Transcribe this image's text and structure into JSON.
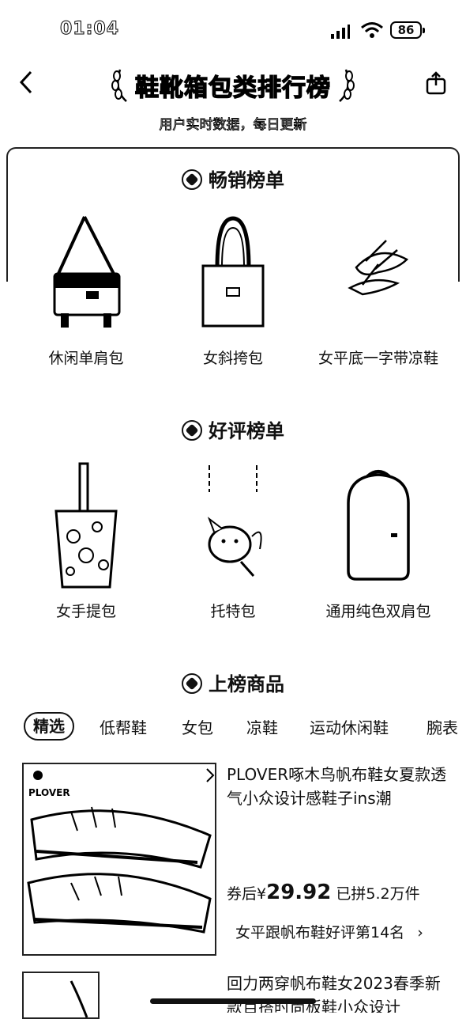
{
  "status_bar": {
    "time": "01:04",
    "battery": "86"
  },
  "header": {
    "title": "鞋靴箱包类排行榜",
    "subtitle": "用户实时数据，每日更新"
  },
  "sections": [
    {
      "title": "畅销榜单",
      "items": [
        {
          "label": "休闲单肩包",
          "icon": "shoulder-bag"
        },
        {
          "label": "女斜挎包",
          "icon": "tote-bag"
        },
        {
          "label": "女平底一字带凉鞋",
          "icon": "sandal"
        }
      ]
    },
    {
      "title": "好评榜单",
      "items": [
        {
          "label": "女手提包",
          "icon": "bucket-bag"
        },
        {
          "label": "托特包",
          "icon": "tote-print"
        },
        {
          "label": "通用纯色双肩包",
          "icon": "backpack"
        }
      ]
    }
  ],
  "listed": {
    "title": "上榜商品",
    "tabs": [
      "精选",
      "低帮鞋",
      "女包",
      "凉鞋",
      "运动休闲鞋",
      "腕表"
    ],
    "active_tab": 0,
    "products": [
      {
        "title": "PLOVER啄木鸟帆布鞋女夏款透气小众设计感鞋子ins潮",
        "price_prefix": "券后",
        "currency": "¥",
        "price": "29.92",
        "sold": "已拼5.2万件",
        "rank_text": "女平跟帆布鞋好评第14名",
        "brand": "PLOVER"
      },
      {
        "title": "回力两穿帆布鞋女2023春季新款百搭时尚板鞋小众设计"
      }
    ]
  }
}
